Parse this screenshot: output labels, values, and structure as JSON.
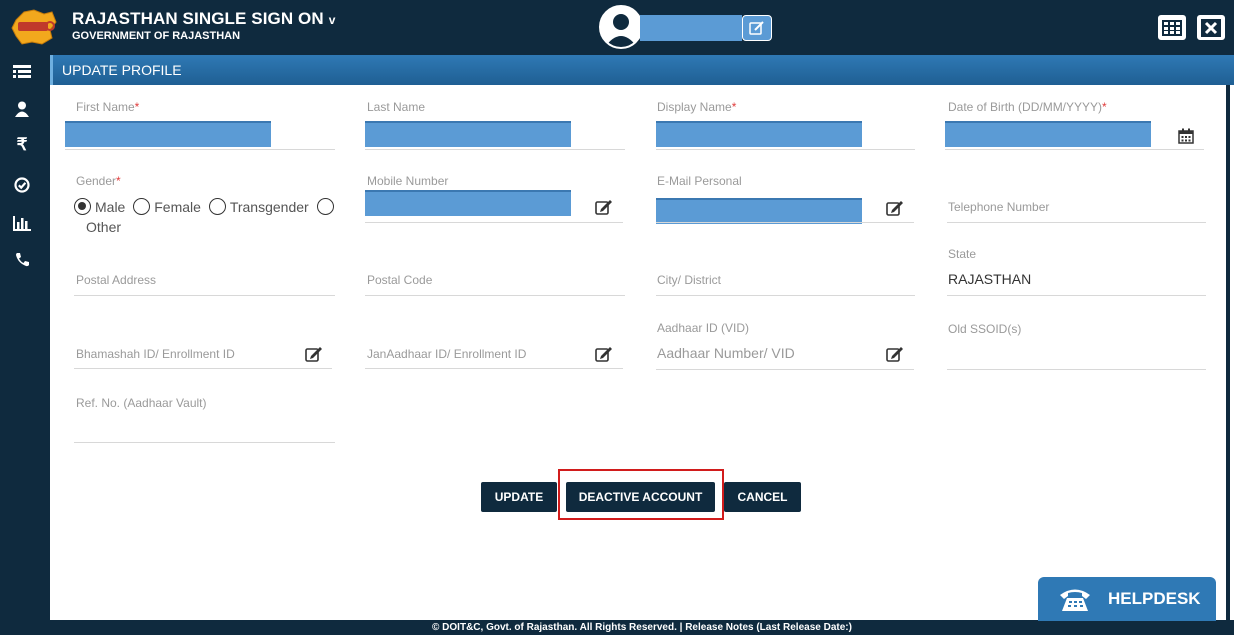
{
  "header": {
    "title": "RAJASTHAN SINGLE SIGN ON",
    "title_caret": "v",
    "subtitle": "GOVERNMENT OF RAJASTHAN"
  },
  "section": {
    "title": "UPDATE PROFILE"
  },
  "form": {
    "first_name_label": "First Name",
    "last_name_label": "Last Name",
    "display_name_label": "Display Name",
    "dob_label": "Date of Birth (DD/MM/YYYY)",
    "gender_label": "Gender",
    "gender_options": [
      "Male",
      "Female",
      "Transgender",
      "Other"
    ],
    "gender_selected": "Male",
    "mobile_label": "Mobile Number",
    "email_label": "E-Mail Personal",
    "telephone_label": "Telephone Number",
    "postal_address_label": "Postal Address",
    "postal_code_label": "Postal Code",
    "city_label": "City/ District",
    "state_label": "State",
    "state_value": "RAJASTHAN",
    "bhamashah_label": "Bhamashah ID/ Enrollment ID",
    "janaadhaar_label": "JanAadhaar ID/ Enrollment ID",
    "aadhaar_label": "Aadhaar ID (VID)",
    "aadhaar_placeholder": "Aadhaar Number/ VID",
    "old_ssoid_label": "Old SSOID(s)",
    "ref_no_label": "Ref. No. (Aadhaar Vault)",
    "required_mark": "*"
  },
  "buttons": {
    "update": "UPDATE",
    "deactivate": "DEACTIVE ACCOUNT",
    "cancel": "CANCEL"
  },
  "footer": {
    "text": "© DOIT&C, Govt. of Rajasthan. All Rights Reserved.  |  Release Notes (Last Release Date:)"
  },
  "helpdesk": {
    "label": "HELPDESK"
  },
  "icons": {
    "sidebar": [
      "menu-list-icon",
      "user-icon",
      "rupee-icon",
      "check-circle-icon",
      "bar-chart-icon",
      "phone-icon"
    ],
    "rupee_glyph": "₹"
  },
  "colors": {
    "header_bg": "#0f2a3e",
    "section_bar": "#2f79b5",
    "redacted_fill": "#5b9bd5",
    "highlight_border": "#d11c1c"
  }
}
